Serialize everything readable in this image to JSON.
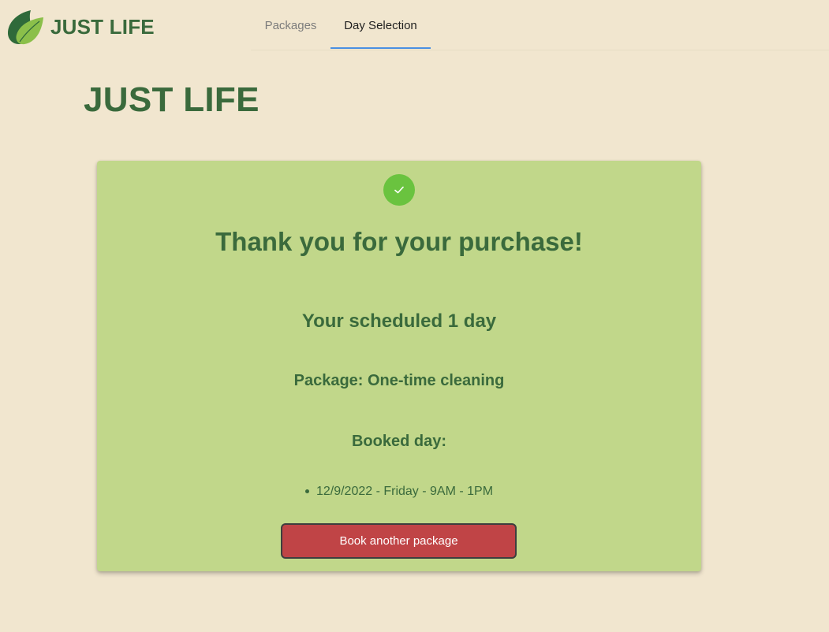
{
  "brand": {
    "name": "JUST LIFE",
    "logo_icon": "leaf-icon",
    "colors": {
      "dark_leaf": "#2f6a3a",
      "light_leaf": "#8bbf4a"
    }
  },
  "nav": {
    "tabs": [
      {
        "label": "Packages",
        "active": false
      },
      {
        "label": "Day Selection",
        "active": true
      }
    ],
    "active_indicator_color": "#4a90e2"
  },
  "page": {
    "title": "JUST LIFE",
    "background_color": "#f1e6cf",
    "text_color": "#3a6a3c"
  },
  "confirmation": {
    "status_icon": "checkmark-icon",
    "status_color": "#6ac33f",
    "card_color": "#c1d78a",
    "heading": "Thank you for your purchase!",
    "subheading": "Your scheduled 1 day",
    "package_line": "Package: One-time cleaning",
    "booked_label": "Booked day:",
    "booked_days": [
      "12/9/2022 - Friday - 9AM - 1PM"
    ],
    "button_label": "Book another package",
    "button_color": "#c04446"
  }
}
